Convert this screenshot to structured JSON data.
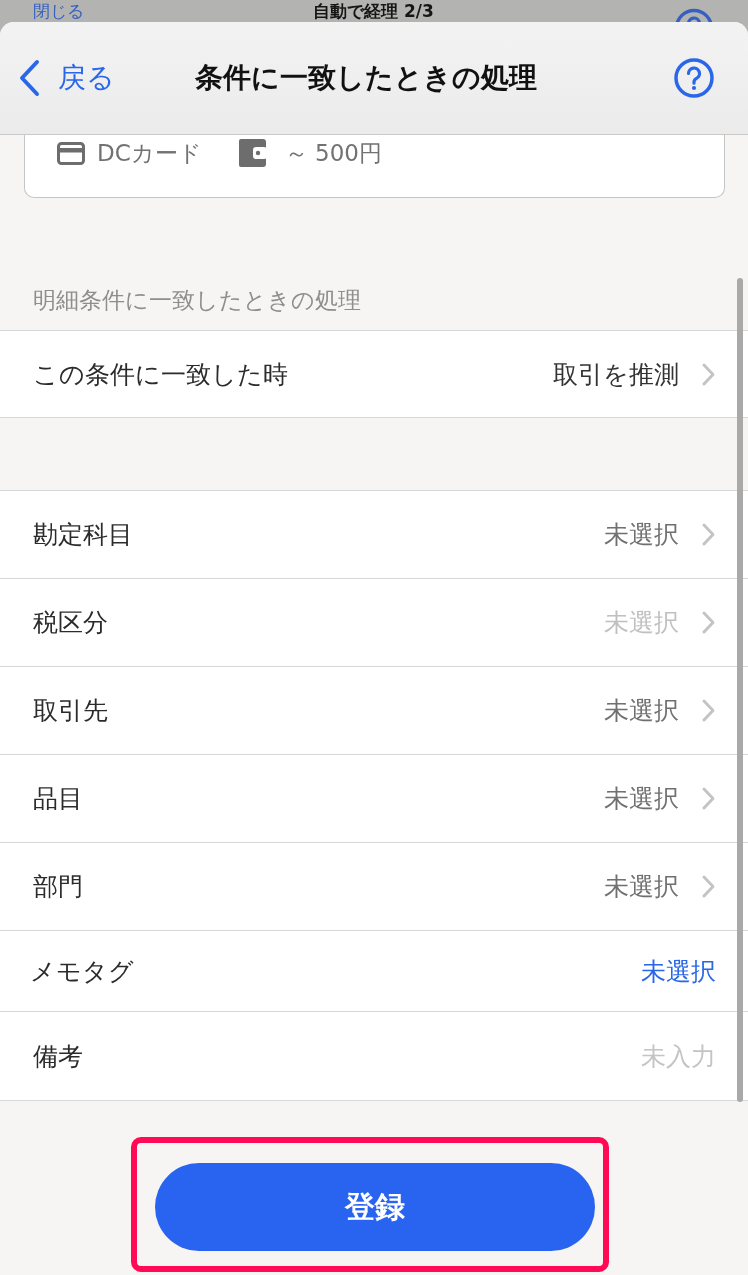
{
  "background_sheet": {
    "close_label": "閉じる",
    "title": "自動で経理 2/3"
  },
  "nav": {
    "back_label": "戻る",
    "title": "条件に一致したときの処理"
  },
  "card": {
    "payment": "DCカード",
    "amount": "～ 500円"
  },
  "section_header": "明細条件に一致したときの処理",
  "action_row": {
    "kind": "select",
    "label": "この条件に一致した時",
    "value": "取引を推測",
    "disabled": false
  },
  "fields": [
    {
      "kind": "select",
      "label": "勘定科目",
      "placeholder": "未選択",
      "disabled": false
    },
    {
      "kind": "select",
      "label": "税区分",
      "placeholder": "未選択",
      "disabled": true
    },
    {
      "kind": "select",
      "label": "取引先",
      "placeholder": "未選択",
      "disabled": false
    },
    {
      "kind": "select",
      "label": "品目",
      "placeholder": "未選択",
      "disabled": false
    },
    {
      "kind": "select",
      "label": "部門",
      "placeholder": "未選択",
      "disabled": false
    },
    {
      "kind": "tag",
      "label": "メモタグ",
      "value": "未選択",
      "disabled": false
    },
    {
      "kind": "input",
      "label": "備考",
      "placeholder": "未入力",
      "disabled": false
    }
  ],
  "register_button": {
    "label": "登録",
    "highlighted": true
  }
}
